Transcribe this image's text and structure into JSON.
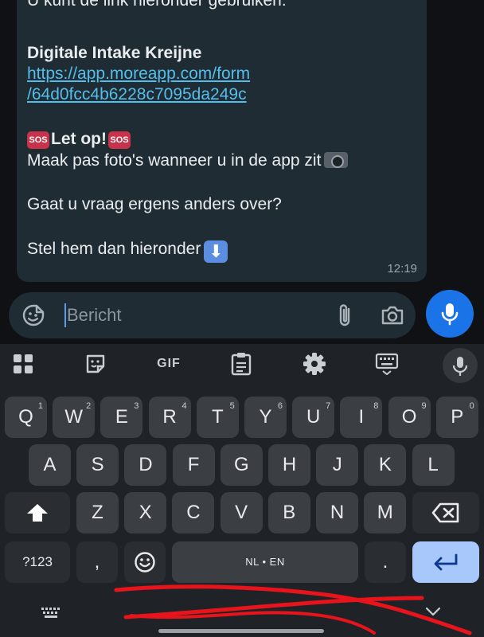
{
  "message": {
    "intro": "U kunt de link hieronder gebruiken:",
    "form_title": "Digitale Intake Kreijne",
    "link_line1": "https://app.moreapp.com/form",
    "link_line2": "/64d0fcc4b6228c7095da249c",
    "sos_badge": "SOS",
    "warning": "Let op!",
    "photo_note": "Maak pas foto's wanneer u in de app zit",
    "question": "Gaat u vraag ergens anders over?",
    "ask_below": "Stel hem dan hieronder",
    "time": "12:19"
  },
  "composer": {
    "placeholder": "Bericht",
    "icons": [
      "sticker-icon",
      "attach-icon",
      "camera-icon",
      "mic-icon"
    ]
  },
  "keyboard": {
    "toolbar": {
      "gif_label": "GIF",
      "icons": [
        "apps-grid-icon",
        "sticker-icon",
        "gif",
        "clipboard-icon",
        "settings-icon",
        "keyboard-icon",
        "voice-mic-icon"
      ]
    },
    "row1": [
      {
        "k": "Q",
        "h": "1"
      },
      {
        "k": "W",
        "h": "2"
      },
      {
        "k": "E",
        "h": "3"
      },
      {
        "k": "R",
        "h": "4"
      },
      {
        "k": "T",
        "h": "5"
      },
      {
        "k": "Y",
        "h": "6"
      },
      {
        "k": "U",
        "h": "7"
      },
      {
        "k": "I",
        "h": "8"
      },
      {
        "k": "O",
        "h": "9"
      },
      {
        "k": "P",
        "h": "0"
      }
    ],
    "row2": [
      "A",
      "S",
      "D",
      "F",
      "G",
      "H",
      "J",
      "K",
      "L"
    ],
    "row3": [
      "Z",
      "X",
      "C",
      "V",
      "B",
      "N",
      "M"
    ],
    "symbols_label": "?123",
    "comma_label": ",",
    "space_label": "NL • EN",
    "period_label": "."
  },
  "colors": {
    "bubble": "#202c33",
    "link": "#53bdeb",
    "mic_button": "#1b73e8",
    "enter_key": "#a8c7fa",
    "annotation_scribble": "#e8141c"
  }
}
